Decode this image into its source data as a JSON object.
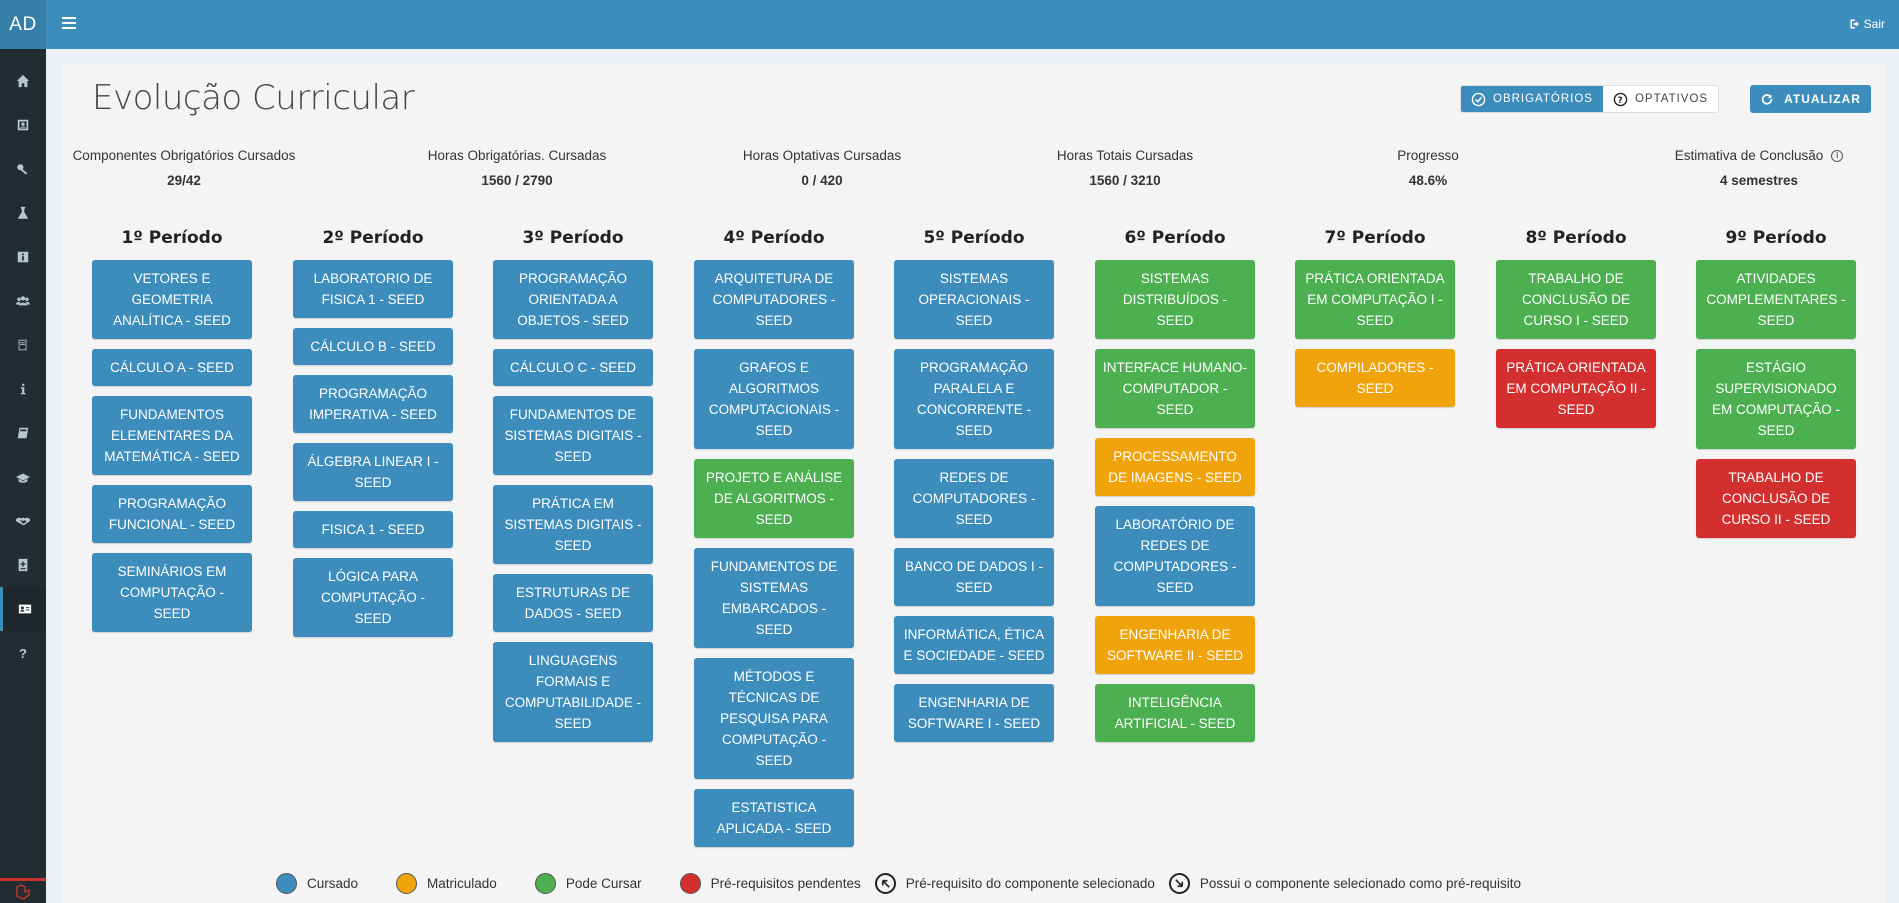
{
  "app": {
    "logo": "AD",
    "logout_label": "Sair"
  },
  "colors": {
    "cursado": "#3c8dbc",
    "matriculado": "#f0a30a",
    "pode_cursar": "#4caf50",
    "pendentes": "#d32f2f"
  },
  "sidebar_icons": [
    "home-icon",
    "id-card-icon",
    "key-icon",
    "flask-icon",
    "info-box-icon",
    "users-icon",
    "book-stack-icon",
    "info-icon",
    "book-icon",
    "graduation-icon",
    "handshake-icon",
    "calculator-icon",
    "address-card-icon",
    "question-icon"
  ],
  "page": {
    "title": "Evolução Curricular",
    "toggle_obrigatorios": "OBRIGATÓRIOS",
    "toggle_optativos": "OPTATIVOS",
    "update_label": "ATUALIZAR"
  },
  "stats": [
    {
      "label": "Componentes Obrigatórios Cursados",
      "value": "29/42"
    },
    {
      "label": "Horas Obrigatórias. Cursadas",
      "value": "1560 / 2790"
    },
    {
      "label": "Horas Optativas Cursadas",
      "value": "0 / 420"
    },
    {
      "label": "Horas Totais Cursadas",
      "value": "1560 / 3210"
    },
    {
      "label": "Progresso",
      "value": "48.6%"
    },
    {
      "label": "Estimativa de Conclusão",
      "value": "4 semestres"
    }
  ],
  "periods": [
    {
      "title": "1º Período",
      "courses": [
        {
          "name": "VETORES E GEOMETRIA ANALÍTICA - SEED",
          "status": "blue"
        },
        {
          "name": "CÁLCULO A - SEED",
          "status": "blue"
        },
        {
          "name": "FUNDAMENTOS ELEMENTARES DA MATEMÁTICA - SEED",
          "status": "blue"
        },
        {
          "name": "PROGRAMAÇÃO FUNCIONAL - SEED",
          "status": "blue"
        },
        {
          "name": "SEMINÁRIOS EM COMPUTAÇÃO - SEED",
          "status": "blue"
        }
      ]
    },
    {
      "title": "2º Período",
      "courses": [
        {
          "name": "LABORATORIO DE FISICA 1 - SEED",
          "status": "blue"
        },
        {
          "name": "CÁLCULO B - SEED",
          "status": "blue"
        },
        {
          "name": "PROGRAMAÇÃO IMPERATIVA - SEED",
          "status": "blue"
        },
        {
          "name": "ÁLGEBRA LINEAR I - SEED",
          "status": "blue"
        },
        {
          "name": "FISICA 1 - SEED",
          "status": "blue"
        },
        {
          "name": "LÓGICA PARA COMPUTAÇÃO - SEED",
          "status": "blue"
        }
      ]
    },
    {
      "title": "3º Período",
      "courses": [
        {
          "name": "PROGRAMAÇÃO ORIENTADA A OBJETOS - SEED",
          "status": "blue"
        },
        {
          "name": "CÁLCULO C - SEED",
          "status": "blue"
        },
        {
          "name": "FUNDAMENTOS DE SISTEMAS DIGITAIS - SEED",
          "status": "blue"
        },
        {
          "name": "PRÁTICA EM SISTEMAS DIGITAIS - SEED",
          "status": "blue"
        },
        {
          "name": "ESTRUTURAS DE DADOS - SEED",
          "status": "blue"
        },
        {
          "name": "LINGUAGENS FORMAIS E COMPUTABILIDADE - SEED",
          "status": "blue"
        }
      ]
    },
    {
      "title": "4º Período",
      "courses": [
        {
          "name": "ARQUITETURA DE COMPUTADORES - SEED",
          "status": "blue"
        },
        {
          "name": "GRAFOS E ALGORITMOS COMPUTACIONAIS - SEED",
          "status": "blue"
        },
        {
          "name": "PROJETO E ANÁLISE DE ALGORITMOS - SEED",
          "status": "green"
        },
        {
          "name": "FUNDAMENTOS DE SISTEMAS EMBARCADOS - SEED",
          "status": "blue"
        },
        {
          "name": "MÉTODOS E TÉCNICAS DE PESQUISA PARA COMPUTAÇÃO - SEED",
          "status": "blue"
        },
        {
          "name": "ESTATISTICA APLICADA - SEED",
          "status": "blue"
        }
      ]
    },
    {
      "title": "5º Período",
      "courses": [
        {
          "name": "SISTEMAS OPERACIONAIS - SEED",
          "status": "blue"
        },
        {
          "name": "PROGRAMAÇÃO PARALELA E CONCORRENTE - SEED",
          "status": "blue"
        },
        {
          "name": "REDES DE COMPUTADORES - SEED",
          "status": "blue"
        },
        {
          "name": "BANCO DE DADOS I - SEED",
          "status": "blue"
        },
        {
          "name": "INFORMÁTICA, ÉTICA E SOCIEDADE - SEED",
          "status": "blue"
        },
        {
          "name": "ENGENHARIA DE SOFTWARE I - SEED",
          "status": "blue"
        }
      ]
    },
    {
      "title": "6º Período",
      "courses": [
        {
          "name": "SISTEMAS DISTRIBUÍDOS - SEED",
          "status": "green"
        },
        {
          "name": "INTERFACE HUMANO-COMPUTADOR - SEED",
          "status": "green"
        },
        {
          "name": "PROCESSAMENTO DE IMAGENS - SEED",
          "status": "orange"
        },
        {
          "name": "LABORATÓRIO DE REDES DE COMPUTADORES - SEED",
          "status": "blue"
        },
        {
          "name": "ENGENHARIA DE SOFTWARE II - SEED",
          "status": "orange"
        },
        {
          "name": "INTELIGÊNCIA ARTIFICIAL - SEED",
          "status": "green"
        }
      ]
    },
    {
      "title": "7º Período",
      "courses": [
        {
          "name": "PRÁTICA ORIENTADA EM COMPUTAÇÃO I - SEED",
          "status": "green"
        },
        {
          "name": "COMPILADORES - SEED",
          "status": "orange"
        }
      ]
    },
    {
      "title": "8º Período",
      "courses": [
        {
          "name": "TRABALHO DE CONCLUSÃO DE CURSO I - SEED",
          "status": "green"
        },
        {
          "name": "PRÁTICA ORIENTADA EM COMPUTAÇÃO II - SEED",
          "status": "red"
        }
      ]
    },
    {
      "title": "9º Período",
      "courses": [
        {
          "name": "ATIVIDADES COMPLEMENTARES - SEED",
          "status": "green"
        },
        {
          "name": "ESTÁGIO SUPERVISIONADO EM COMPUTAÇÃO - SEED",
          "status": "green"
        },
        {
          "name": "TRABALHO DE CONCLUSÃO DE CURSO II - SEED",
          "status": "red"
        }
      ]
    }
  ],
  "legend": {
    "cursado": "Cursado",
    "matriculado": "Matriculado",
    "pode_cursar": "Pode Cursar",
    "pendentes": "Pré-requisitos pendentes",
    "prereq_of_selected": "Pré-requisito do componente selecionado",
    "has_selected_as_prereq": "Possui o componente selecionado como pré-requisito"
  }
}
